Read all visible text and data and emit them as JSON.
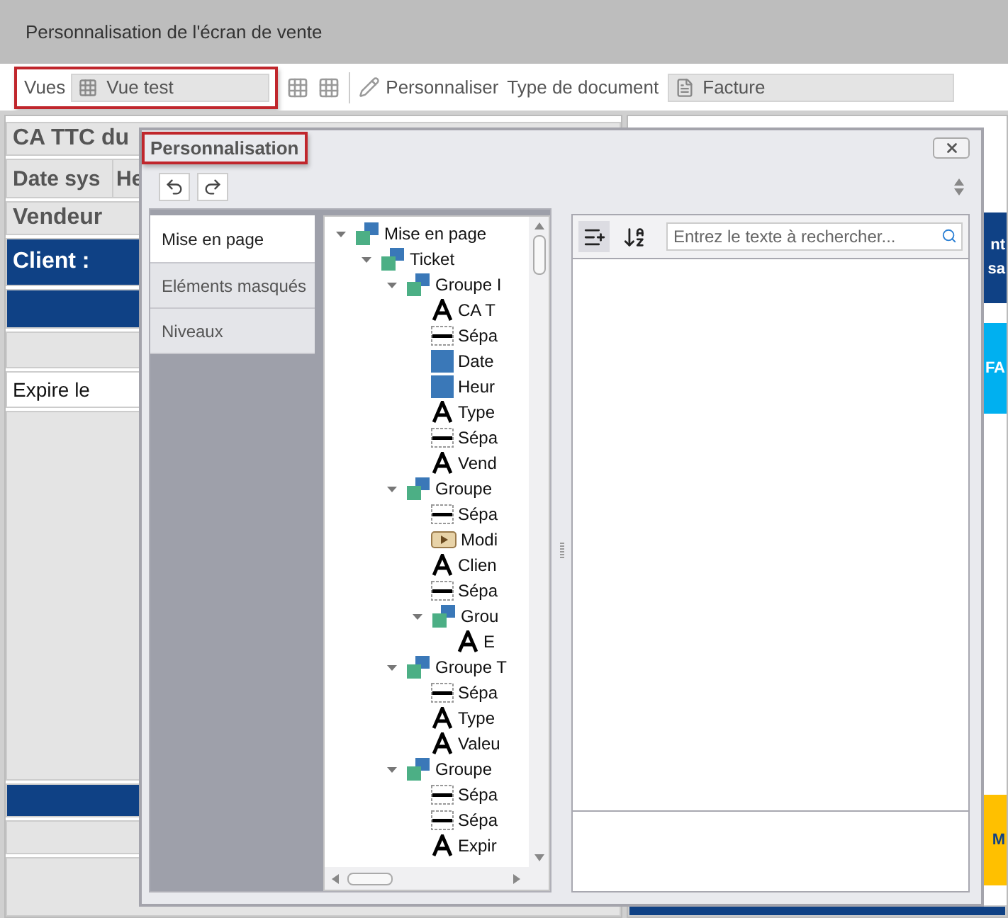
{
  "window": {
    "title": "Personnalisation de l'écran de vente"
  },
  "toolbar": {
    "views_label": "Vues",
    "view": "Vue test",
    "customize": "Personnaliser",
    "doc_type_label": "Type de document",
    "doc_type": "Facture"
  },
  "sales_panel": {
    "total_label": "CA TTC du",
    "date_label": "Date sys",
    "time_label": "He",
    "seller_label": "Vendeur",
    "client_label": "Client :",
    "expiry_label": "Expire le"
  },
  "side_tiles": [
    {
      "lines": [
        "nt",
        "sa"
      ],
      "color": "#0f4185"
    },
    {
      "lines": [
        "FA"
      ],
      "color": "#00b0f0"
    },
    {
      "lines": [
        "M"
      ],
      "color": "#ffc000"
    }
  ],
  "dialog": {
    "title": "Personnalisation",
    "tabs": [
      {
        "label": "Mise en page",
        "selected": true
      },
      {
        "label": "Eléments masqués",
        "selected": false
      },
      {
        "label": "Niveaux",
        "selected": false
      }
    ],
    "tree": [
      {
        "label": "Mise en page",
        "kind": "group",
        "expanded": true,
        "children": [
          {
            "label": "Ticket",
            "kind": "group",
            "expanded": true,
            "children": [
              {
                "label": "Groupe I",
                "kind": "group",
                "expanded": true,
                "children": [
                  {
                    "label": "CA T",
                    "kind": "text"
                  },
                  {
                    "label": "Sépa",
                    "kind": "separator"
                  },
                  {
                    "label": "Date",
                    "kind": "field"
                  },
                  {
                    "label": "Heur",
                    "kind": "field"
                  },
                  {
                    "label": "Type",
                    "kind": "text"
                  },
                  {
                    "label": "Sépa",
                    "kind": "separator"
                  },
                  {
                    "label": "Vend",
                    "kind": "text"
                  }
                ]
              },
              {
                "label": "Groupe",
                "kind": "group",
                "expanded": true,
                "children": [
                  {
                    "label": "Sépa",
                    "kind": "separator"
                  },
                  {
                    "label": "Modi",
                    "kind": "media"
                  },
                  {
                    "label": "Clien",
                    "kind": "text"
                  },
                  {
                    "label": "Sépa",
                    "kind": "separator"
                  },
                  {
                    "label": "Grou",
                    "kind": "group",
                    "expanded": true,
                    "children": [
                      {
                        "label": "E",
                        "kind": "text"
                      }
                    ]
                  }
                ]
              },
              {
                "label": "Groupe T",
                "kind": "group",
                "expanded": true,
                "children": [
                  {
                    "label": "Sépa",
                    "kind": "separator"
                  },
                  {
                    "label": "Type",
                    "kind": "text"
                  },
                  {
                    "label": "Valeu",
                    "kind": "text"
                  }
                ]
              },
              {
                "label": "Groupe",
                "kind": "group",
                "expanded": true,
                "children": [
                  {
                    "label": "Sépa",
                    "kind": "separator"
                  },
                  {
                    "label": "Sépa",
                    "kind": "separator"
                  },
                  {
                    "label": "Expir",
                    "kind": "text"
                  }
                ]
              }
            ]
          }
        ]
      }
    ],
    "search": {
      "placeholder": "Entrez le texte à rechercher..."
    }
  }
}
